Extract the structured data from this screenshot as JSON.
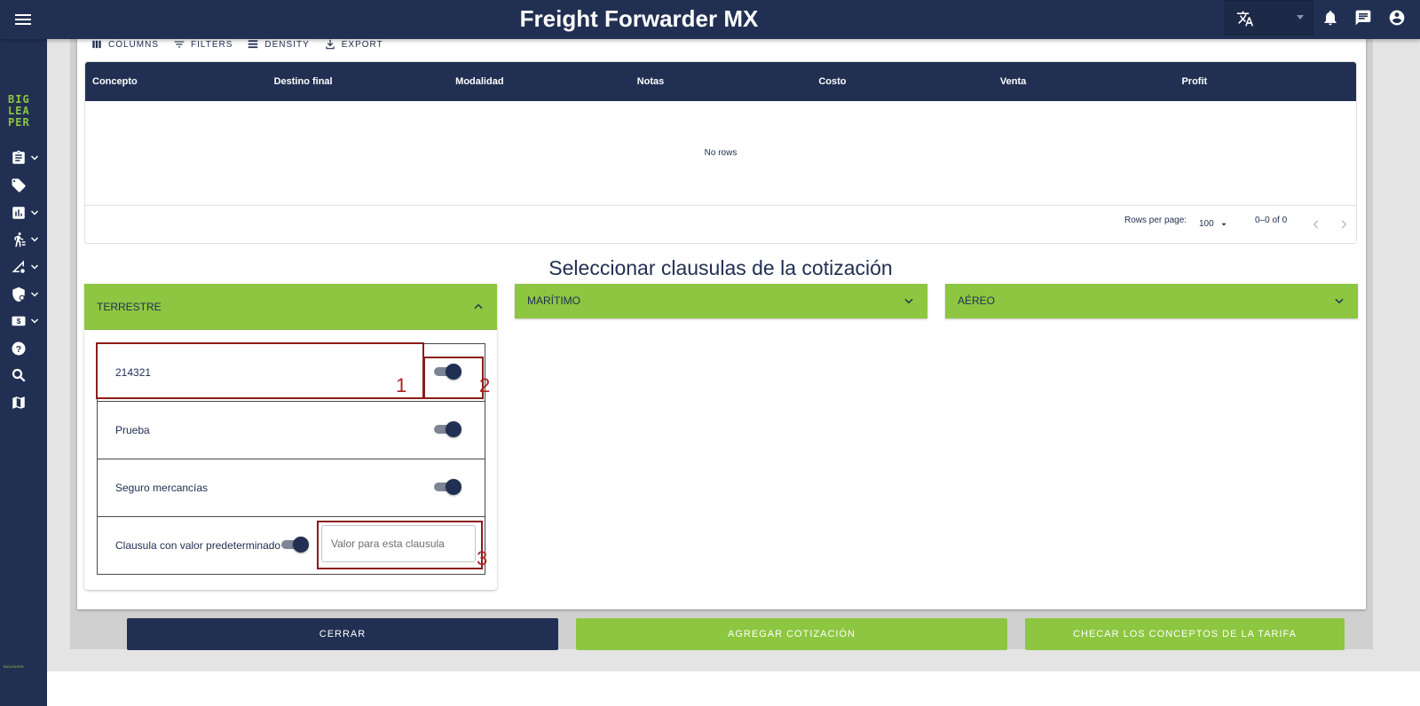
{
  "app": {
    "title": "Freight Forwarder MX",
    "logo_text": "BIG LEA PER",
    "footer_logo": "BIGLEAPER"
  },
  "topbar": {
    "icons": [
      "menu-icon",
      "translate-icon",
      "bell-icon",
      "chat-icon",
      "account-icon"
    ]
  },
  "sidebar": {
    "items": [
      "clipboard-icon",
      "tag-icon",
      "chart-icon",
      "walker-icon",
      "tools-icon",
      "shield-icon",
      "money-icon",
      "help-icon",
      "search-icon",
      "map-icon"
    ]
  },
  "grid": {
    "toolbar": {
      "columns": "COLUMNS",
      "filters": "FILTERS",
      "density": "DENSITY",
      "export": "EXPORT"
    },
    "columns": [
      "Concepto",
      "Destino final",
      "Modalidad",
      "Notas",
      "Costo",
      "Venta",
      "Profit"
    ],
    "empty_text": "No rows",
    "footer": {
      "rows_per_page_label": "Rows per page:",
      "rows_per_page_value": "100",
      "range": "0–0 of 0"
    }
  },
  "clauses_section": {
    "title": "Seleccionar clausulas de la cotización",
    "accordions": [
      {
        "label": "TERRESTRE",
        "expanded": true
      },
      {
        "label": "MARÍTIMO",
        "expanded": false
      },
      {
        "label": "AÉREO",
        "expanded": false
      }
    ],
    "items": [
      {
        "label": "214321",
        "enabled": true
      },
      {
        "label": "Prueba",
        "enabled": true
      },
      {
        "label": "Seguro mercancías",
        "enabled": true
      },
      {
        "label": "Clausula con valor predeterminado",
        "enabled": true,
        "input_placeholder": "Valor para esta clausula",
        "input_value": ""
      }
    ]
  },
  "annotations": [
    "1",
    "2",
    "3"
  ],
  "actions": {
    "close": "CERRAR",
    "add_quote": "AGREGAR COTIZACIÓN",
    "check_concepts": "CHECAR LOS CONCEPTOS DE LA TARIFA"
  },
  "colors": {
    "navy": "#213052",
    "green": "#8dc641",
    "annotation": "#8b1c1c"
  }
}
